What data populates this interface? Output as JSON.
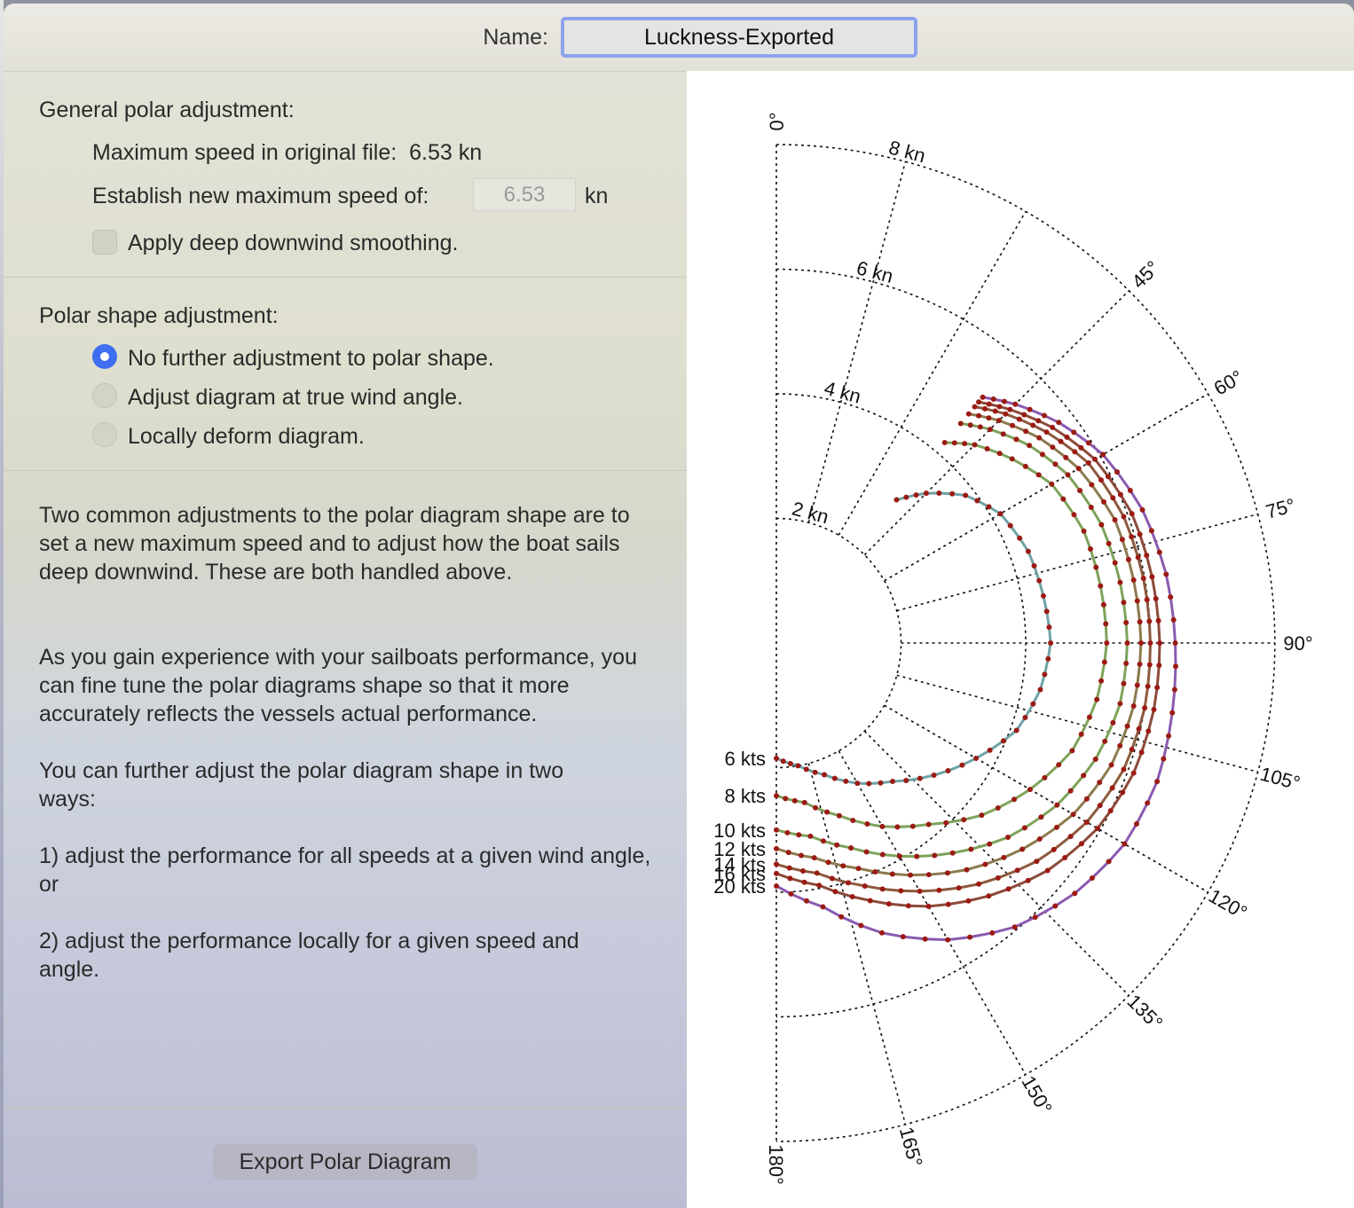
{
  "dialog": {
    "name_label": "Name:",
    "name_value": "Luckness-Exported"
  },
  "general": {
    "title": "General polar adjustment:",
    "max_original_label": "Maximum speed in original file:",
    "max_original_value": "6.53 kn",
    "new_max_label": "Establish new maximum speed of:",
    "new_max_value": "6.53",
    "new_max_unit": "kn",
    "smoothing_label": "Apply deep downwind smoothing.",
    "smoothing_checked": false
  },
  "shape": {
    "title": "Polar shape adjustment:",
    "options": [
      {
        "label": "No further adjustment to polar shape.",
        "selected": true
      },
      {
        "label": "Adjust diagram at true wind angle.",
        "selected": false
      },
      {
        "label": "Locally deform diagram.",
        "selected": false
      }
    ]
  },
  "help": {
    "p1": "Two common adjustments to the polar diagram shape are to set a new maximum speed and to adjust how the boat sails deep downwind.  These are both handled above.",
    "p2": "As you gain experience with your sailboats performance, you can fine tune the polar diagrams shape so that it more accurately reflects the vessels actual performance.",
    "p3": "You can further adjust the polar diagram shape in two ways:",
    "p4": "1) adjust the performance for all speeds at a given wind angle, or",
    "p5": "2) adjust the performance locally for a given speed and angle."
  },
  "export_label": "Export Polar Diagram",
  "colors": {
    "point": "#9b1b14",
    "series": [
      "#6fa3a7",
      "#7ea35a",
      "#7ea35a",
      "#8c7a4e",
      "#8d5a3e",
      "#8c4a3a",
      "#8a5ab0"
    ]
  },
  "chart_data": {
    "type": "polar",
    "angle_labels": [
      "0°",
      "45°",
      "60°",
      "75°",
      "90°",
      "105°",
      "120°",
      "135°",
      "150°",
      "165°",
      "180°"
    ],
    "radial_labels": [
      "2 kn",
      "4 kn",
      "6 kn",
      "8 kn"
    ],
    "radial_values": [
      2,
      4,
      6,
      8
    ],
    "angle_range": [
      0,
      180
    ],
    "radius_max": 8,
    "angles": [
      40,
      45,
      52,
      60,
      70,
      80,
      90,
      100,
      110,
      120,
      130,
      140,
      150,
      160,
      170,
      180
    ],
    "series": [
      {
        "name": "6 kts",
        "values": [
          3.0,
          3.4,
          3.85,
          4.15,
          4.3,
          4.35,
          4.4,
          4.3,
          4.1,
          3.7,
          3.3,
          2.9,
          2.6,
          2.25,
          2.0,
          1.85
        ]
      },
      {
        "name": "8 kts",
        "values": [
          4.2,
          4.5,
          4.8,
          5.1,
          5.25,
          5.28,
          5.3,
          5.22,
          5.05,
          4.7,
          4.3,
          3.8,
          3.4,
          2.95,
          2.6,
          2.45
        ]
      },
      {
        "name": "10 kts",
        "values": [
          4.6,
          4.85,
          5.15,
          5.4,
          5.55,
          5.6,
          5.63,
          5.6,
          5.45,
          5.2,
          4.85,
          4.4,
          3.95,
          3.5,
          3.15,
          3.0
        ]
      },
      {
        "name": "12 kts",
        "values": [
          4.8,
          5.05,
          5.35,
          5.6,
          5.78,
          5.82,
          5.85,
          5.82,
          5.72,
          5.5,
          5.15,
          4.75,
          4.3,
          3.85,
          3.5,
          3.3
        ]
      },
      {
        "name": "14 kts",
        "values": [
          4.95,
          5.2,
          5.5,
          5.78,
          5.93,
          5.98,
          6.0,
          6.0,
          5.93,
          5.75,
          5.45,
          5.05,
          4.6,
          4.15,
          3.75,
          3.55
        ]
      },
      {
        "name": "16 kts",
        "values": [
          5.05,
          5.3,
          5.62,
          5.9,
          6.07,
          6.12,
          6.15,
          6.15,
          6.1,
          5.95,
          5.68,
          5.3,
          4.88,
          4.4,
          3.95,
          3.7
        ]
      },
      {
        "name": "20 kts",
        "values": [
          5.15,
          5.42,
          5.75,
          6.05,
          6.25,
          6.35,
          6.4,
          6.45,
          6.5,
          6.45,
          6.25,
          5.95,
          5.5,
          4.95,
          4.3,
          3.9
        ]
      }
    ]
  }
}
